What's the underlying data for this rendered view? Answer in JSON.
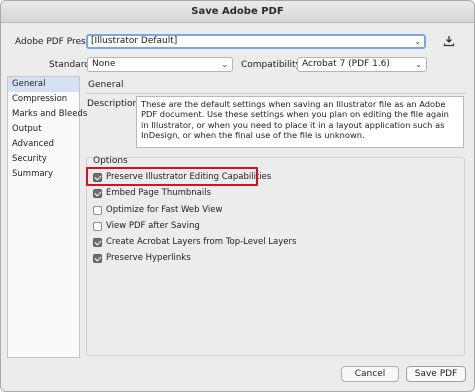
{
  "window": {
    "title": "Save Adobe PDF"
  },
  "preset": {
    "label": "Adobe PDF Preset:",
    "value": "[Illustrator Default]"
  },
  "standard": {
    "label": "Standard:",
    "value": "None"
  },
  "compatibility": {
    "label": "Compatibility:",
    "value": "Acrobat 7 (PDF 1.6)"
  },
  "sidebar": {
    "items": [
      {
        "label": "General",
        "active": true
      },
      {
        "label": "Compression"
      },
      {
        "label": "Marks and Bleeds"
      },
      {
        "label": "Output"
      },
      {
        "label": "Advanced"
      },
      {
        "label": "Security"
      },
      {
        "label": "Summary"
      }
    ]
  },
  "general": {
    "heading": "General",
    "description_label": "Description:",
    "description": "These are the default settings when saving an Illustrator file as an Adobe PDF document. Use these settings when you plan on editing the file again in Illustrator, or when you need to place it in a layout application such as InDesign, or when the final use of the file is unknown."
  },
  "options": {
    "title": "Options",
    "items": [
      {
        "label": "Preserve Illustrator Editing Capabilities",
        "checked": true,
        "highlighted": true
      },
      {
        "label": "Embed Page Thumbnails",
        "checked": true
      },
      {
        "label": "Optimize for Fast Web View",
        "checked": false
      },
      {
        "label": "View PDF after Saving",
        "checked": false
      },
      {
        "label": "Create Acrobat Layers from Top-Level Layers",
        "checked": true
      },
      {
        "label": "Preserve Hyperlinks",
        "checked": true
      }
    ]
  },
  "buttons": {
    "cancel": "Cancel",
    "save": "Save PDF"
  },
  "colors": {
    "highlight": "#d4141c",
    "focus_ring": "#7ca6e0",
    "active_item": "#d6e2f4"
  },
  "icons": {
    "chevron": "chevron-down-icon",
    "save_preset": "save-preset-icon"
  }
}
